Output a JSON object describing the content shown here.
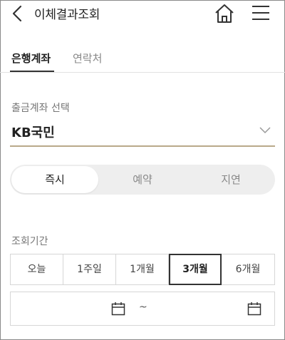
{
  "header": {
    "title": "이체결과조회"
  },
  "tabs": [
    {
      "label": "은행계좌",
      "active": true
    },
    {
      "label": "연락처",
      "active": false
    }
  ],
  "account": {
    "label": "출금계좌 선택",
    "value": "KB국민"
  },
  "transfer_type": {
    "options": [
      "즉시",
      "예약",
      "지연"
    ],
    "selected": "즉시"
  },
  "period": {
    "label": "조회기간",
    "options": [
      "오늘",
      "1주일",
      "1개월",
      "3개월",
      "6개월"
    ],
    "selected": "3개월"
  },
  "date_range": {
    "separator": "~"
  },
  "colors": {
    "account_underline": "#b9a98a",
    "segment_bg": "#eeeeee",
    "text_primary": "#222222",
    "text_muted": "#888888"
  },
  "icons": {
    "back": "chevron-left-icon",
    "home": "home-icon",
    "menu": "hamburger-menu-icon",
    "dropdown": "chevron-down-icon",
    "calendar": "calendar-icon"
  }
}
